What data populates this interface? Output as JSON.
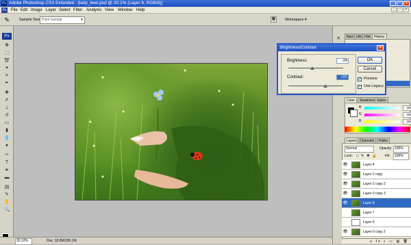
{
  "window": {
    "title": "Adobe Photoshop CS3 Extended - [lady_bwo.psd @ 20.1% (Layer 8, RGB/8)]"
  },
  "menu": {
    "items": [
      "File",
      "Edit",
      "Image",
      "Layer",
      "Select",
      "Filter",
      "Analysis",
      "View",
      "Window",
      "Help"
    ]
  },
  "options": {
    "sample_size_label": "Sample Size:",
    "sample_size_value": "Point Sample",
    "workspace_label": "Workspace ▾"
  },
  "tools_header": "Ps",
  "status": {
    "zoom": "20.12%",
    "doc": "Doc: 18.0M/290.1M"
  },
  "panels": {
    "top_tabs": [
      "Navi",
      "Info",
      "Hist",
      "History"
    ],
    "color_tabs": [
      "Color",
      "Swatches",
      "Styles"
    ],
    "color_values": {
      "r": "255",
      "g": "255",
      "b": "255"
    },
    "layers_tabs": [
      "Layers",
      "Channels",
      "Paths"
    ],
    "blend_mode": "Normal",
    "opacity_label": "Opacity:",
    "opacity_value": "100%",
    "fill_label": "Fill:",
    "fill_value": "100%",
    "lock_label": "Lock:",
    "layers": [
      {
        "name": "Layer 4",
        "visible": true,
        "selected": false,
        "thumb": "green"
      },
      {
        "name": "Layer 2 copy",
        "visible": true,
        "selected": false,
        "thumb": "green"
      },
      {
        "name": "Layer 2 copy 2",
        "visible": true,
        "selected": false,
        "thumb": "green"
      },
      {
        "name": "Layer 0 copy 3",
        "visible": true,
        "selected": false,
        "thumb": "green"
      },
      {
        "name": "Layer 8",
        "visible": true,
        "selected": true,
        "thumb": "green"
      },
      {
        "name": "Layer 7",
        "visible": false,
        "selected": false,
        "thumb": "green"
      },
      {
        "name": "Layer 6",
        "visible": false,
        "selected": false,
        "thumb": "white"
      },
      {
        "name": "Layer 0 copy 2",
        "visible": true,
        "selected": false,
        "thumb": "green"
      }
    ]
  },
  "dialog": {
    "title": "Brightness/Contrast",
    "brightness_label": "Brightness:",
    "brightness_value": "-24",
    "contrast_label": "Contrast:",
    "contrast_value": "+21",
    "ok_label": "OK",
    "cancel_label": "Cancel",
    "preview_label": "Preview",
    "use_legacy_label": "Use Legacy",
    "preview_checked": true,
    "use_legacy_checked": true
  },
  "colors": {
    "title_bar": "#1e4fc0",
    "selected_layer": "#316ac5",
    "ladybug": "#d8361c"
  }
}
